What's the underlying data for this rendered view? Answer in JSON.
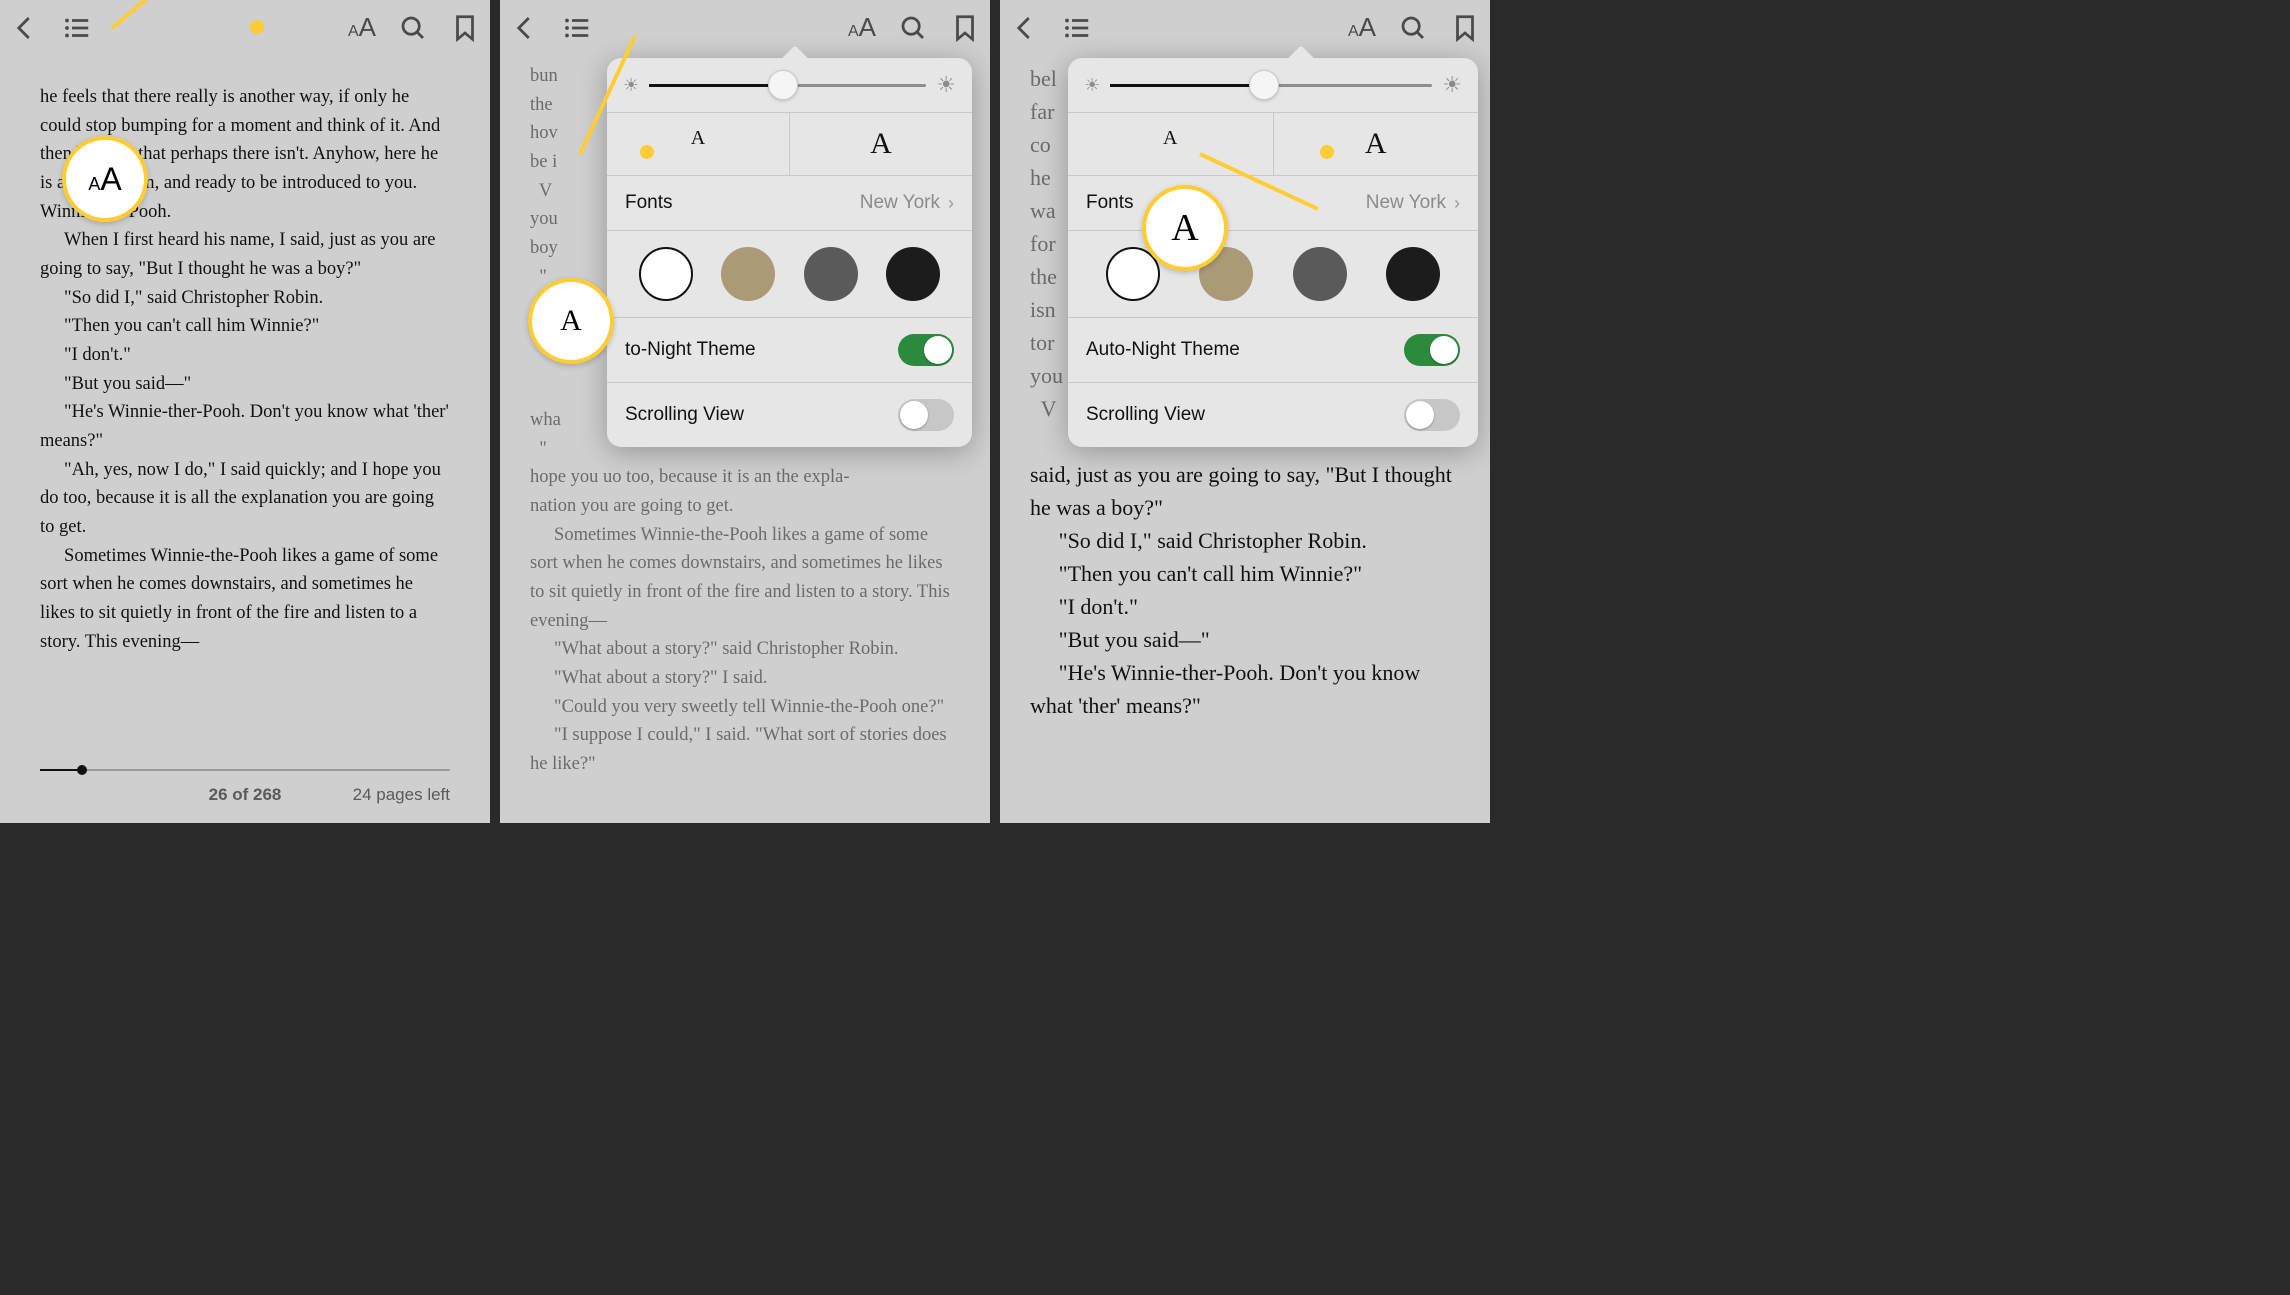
{
  "toolbar_icons": {
    "back": "back-icon",
    "toc": "toc-icon",
    "appearance": "aA",
    "search": "search-icon",
    "bookmark": "bookmark-icon"
  },
  "screen1": {
    "paragraphs": [
      "he feels that there really is another way, if only he could stop bumping for a moment and think of it. And then he feels that perhaps there isn't. Anyhow, here he is at the bottom, and ready to be introduced to you. Winnie-the-Pooh.",
      "When I first heard his name, I said, just as you are going to say, \"But I thought he was a boy?\"",
      "\"So did I,\" said Christopher Robin.",
      "\"Then you can't call him Winnie?\"",
      "\"I don't.\"",
      "\"But you said—\"",
      "\"He's Winnie-ther-Pooh. Don't you know what 'ther' means?\"",
      "\"Ah, yes, now I do,\" I said quickly; and I hope you do too, because it is all the explanation you are going to get.",
      "Sometimes Winnie-the-Pooh likes a game of some sort when he comes downstairs, and sometimes he likes to sit quietly in front of the fire and listen to a story. This evening—"
    ],
    "footer_center": "26 of 268",
    "footer_right": "24 pages left",
    "callout_label_small": "A",
    "callout_label_big": "A"
  },
  "popover": {
    "size_small": "A",
    "size_large": "A",
    "fonts_label": "Fonts",
    "fonts_value": "New York",
    "auto_night_label": "Auto-Night Theme",
    "auto_night_label_cut": "to-Night Theme",
    "scrolling_label": "Scrolling View"
  },
  "screen2": {
    "bg_lines": "bun\nthe\nhov\nbe i\n  V\nyou\nboy\n  \"\n\n\n\n\nwha\n  \"\nhope you uo too, because it is an the expla-",
    "bg_rest": [
      "nation you are going to get.",
      "Sometimes Winnie-the-Pooh likes a game of some sort when he comes downstairs, and sometimes he likes to sit quietly in front of the fire and listen to a story. This evening—",
      "\"What about a story?\" said Christopher Robin.",
      "\"What about a story?\" I said.",
      "\"Could you very sweetly tell Winnie-the-Pooh one?\"",
      "\"I suppose I could,\" I said. \"What sort of stories does he like?\""
    ],
    "callout_label": "A"
  },
  "screen3": {
    "bg_left": "bel\nfar\nco\nhe\nwa\nfor\nthe\nisn\ntor\nyou\n  V",
    "bg_below": [
      "said, just as you are going to say, \"But I thought he was a boy?\"",
      "\"So did I,\" said Christopher Robin.",
      "\"Then you can't call him Winnie?\"",
      "\"I don't.\"",
      "\"But you said—\"",
      "\"He's Winnie-ther-Pooh. Don't you know what 'ther' means?\""
    ],
    "callout_label": "A"
  }
}
